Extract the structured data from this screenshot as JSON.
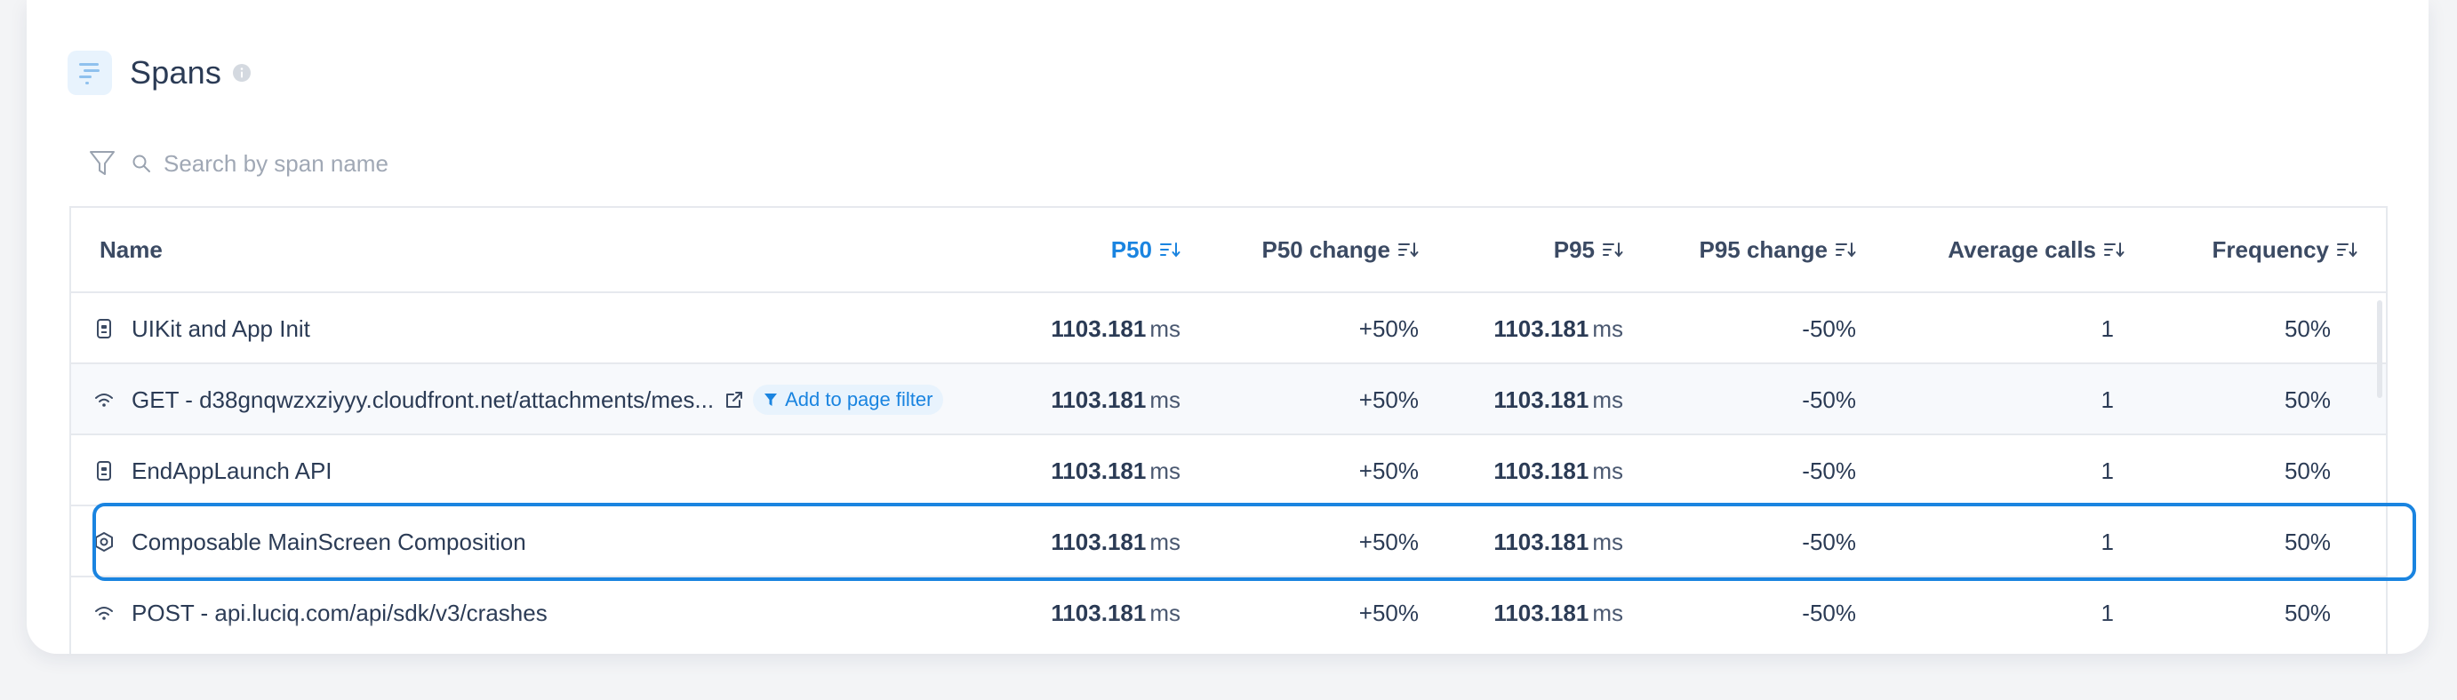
{
  "panel": {
    "title": "Spans",
    "title_icon": "spans-icon",
    "info_icon": "info-icon"
  },
  "search": {
    "placeholder": "Search by span name",
    "value": ""
  },
  "columns": {
    "name": "Name",
    "p50": "P50",
    "p50_change": "P50 change",
    "p95": "P95",
    "p95_change": "P95 change",
    "average_calls": "Average calls",
    "frequency": "Frequency"
  },
  "sorted_column": "P50",
  "rows": [
    {
      "icon": "device-icon",
      "name": "UIKit and App Init",
      "p50": "1103.181",
      "p50_unit": "ms",
      "p50_change": "+50%",
      "p95": "1103.181",
      "p95_unit": "ms",
      "p95_change": "-50%",
      "average_calls": "1",
      "frequency": "50%"
    },
    {
      "icon": "network-icon",
      "name": "GET - d38gnqwzxziyyy.cloudfront.net/attachments/mes...",
      "external_link_icon": "external-link-icon",
      "chip_label": "Add to page filter",
      "p50": "1103.181",
      "p50_unit": "ms",
      "p50_change": "+50%",
      "p95": "1103.181",
      "p95_unit": "ms",
      "p95_change": "-50%",
      "average_calls": "1",
      "frequency": "50%"
    },
    {
      "icon": "device-icon",
      "name": "EndAppLaunch API",
      "p50": "1103.181",
      "p50_unit": "ms",
      "p50_change": "+50%",
      "p95": "1103.181",
      "p95_unit": "ms",
      "p95_change": "-50%",
      "average_calls": "1",
      "frequency": "50%"
    },
    {
      "icon": "composable-icon",
      "name": "Composable MainScreen Composition",
      "p50": "1103.181",
      "p50_unit": "ms",
      "p50_change": "+50%",
      "p95": "1103.181",
      "p95_unit": "ms",
      "p95_change": "-50%",
      "average_calls": "1",
      "frequency": "50%"
    },
    {
      "icon": "network-icon",
      "name": "POST - api.luciq.com/api/sdk/v3/crashes",
      "p50": "1103.181",
      "p50_unit": "ms",
      "p50_change": "+50%",
      "p95": "1103.181",
      "p95_unit": "ms",
      "p95_change": "-50%",
      "average_calls": "1",
      "frequency": "50%"
    }
  ],
  "colors": {
    "accent": "#1a84e0",
    "text": "#2b3b55",
    "border": "#e6e9ee",
    "chip_bg": "#e8f3fd"
  }
}
